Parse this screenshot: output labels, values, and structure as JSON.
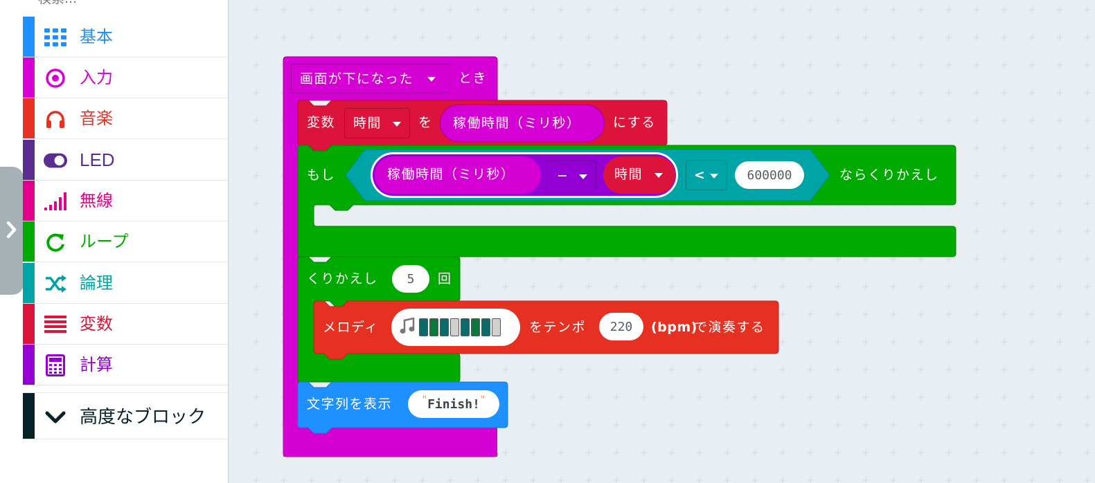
{
  "toolbox": {
    "search_placeholder": "検索...",
    "categories": [
      {
        "label": "基本",
        "color": "#1e90ff",
        "icon": "grid-icon"
      },
      {
        "label": "入力",
        "color": "#d400d4",
        "icon": "target-icon"
      },
      {
        "label": "音楽",
        "color": "#e63022",
        "icon": "headphones-icon"
      },
      {
        "label": "LED",
        "color": "#5c2d91",
        "icon": "toggle-icon"
      },
      {
        "label": "無線",
        "color": "#e3008c",
        "icon": "signal-bars-icon"
      },
      {
        "label": "ループ",
        "color": "#00aa00",
        "icon": "loop-arrow-icon"
      },
      {
        "label": "論理",
        "color": "#00a4a6",
        "icon": "shuffle-icon"
      },
      {
        "label": "変数",
        "color": "#dc143c",
        "icon": "list-lines-icon"
      },
      {
        "label": "計算",
        "color": "#9400d3",
        "icon": "calculator-icon"
      }
    ],
    "advanced": {
      "label": "高度なブロック",
      "color": "#062128",
      "icon": "chevron-down-icon"
    }
  },
  "blocks": {
    "event": {
      "trigger": "画面が下になった",
      "suffix": "とき",
      "color": "#d400d4"
    },
    "set_var": {
      "prefix": "変数",
      "var_name": "時間",
      "mid": "を",
      "value": "稼働時間（ミリ秒）",
      "suffix": "にする",
      "color": "#dc143c"
    },
    "while_loop": {
      "prefix": "もし",
      "left": "稼働時間（ミリ秒）",
      "operator": "−",
      "right": "時間",
      "compare": "<",
      "limit": "600000",
      "suffix": "ならくりかえし",
      "color": "#00aa00"
    },
    "repeat": {
      "prefix": "くりかえし",
      "count": "5",
      "suffix": "回",
      "color": "#00aa00"
    },
    "melody": {
      "prefix": "メロディ",
      "mid": "をテンポ",
      "tempo": "220",
      "bpm": "(bpm)",
      "suffix": "で演奏する",
      "color": "#e63022",
      "note_icon": "music-note-icon",
      "notes": [
        1,
        1,
        1,
        0,
        1,
        1,
        1,
        0
      ]
    },
    "show_string": {
      "prefix": "文字列を表示",
      "open_quote": "\"",
      "text": "Finish!",
      "close_quote": "\"",
      "color": "#1e90ff"
    }
  }
}
